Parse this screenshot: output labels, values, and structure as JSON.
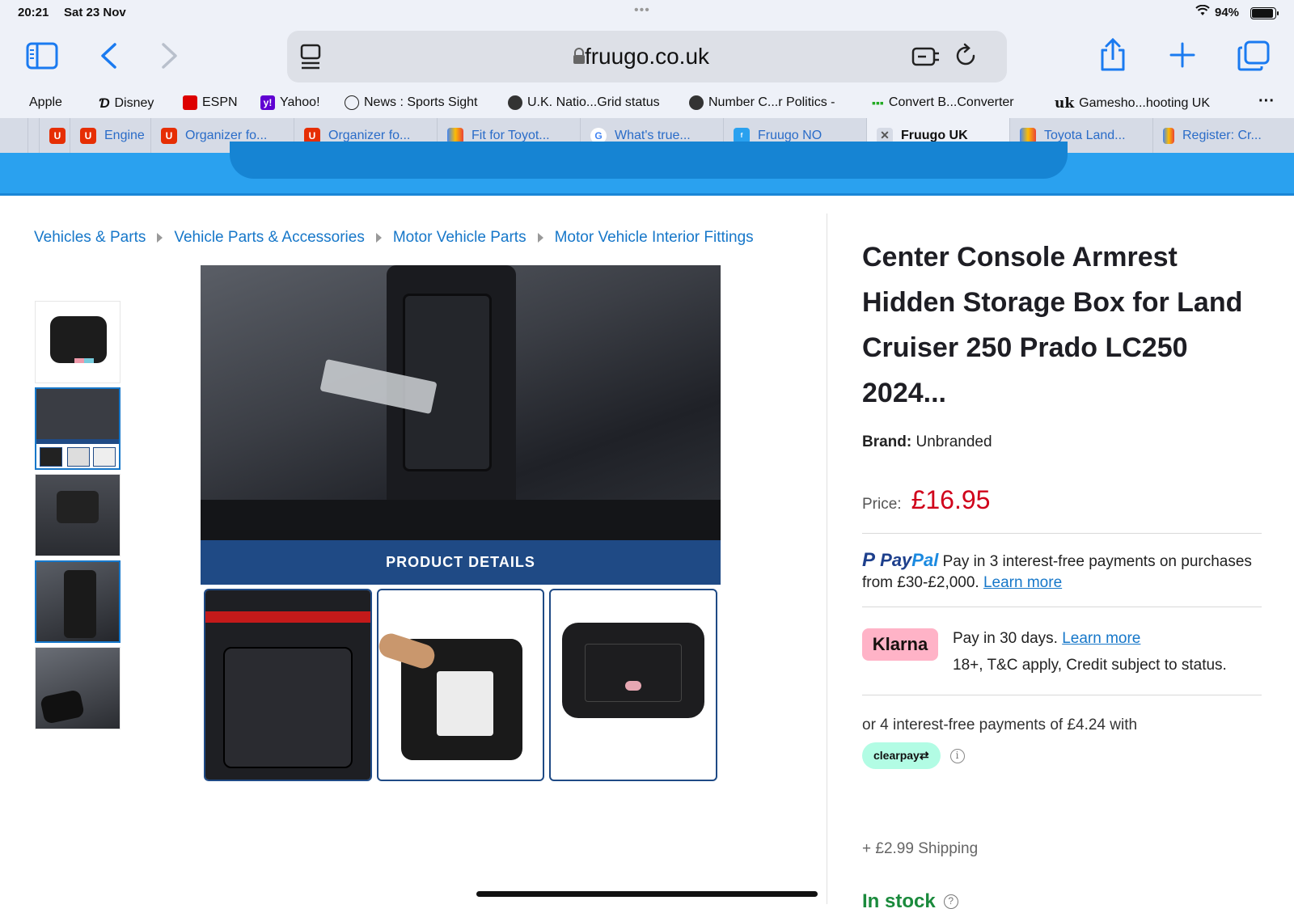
{
  "status": {
    "time": "20:21",
    "date": "Sat 23 Nov",
    "battery": "94%",
    "battery_level": 0.94
  },
  "browser": {
    "url": "fruugo.co.uk"
  },
  "favourites": [
    "Apple",
    "Disney",
    "ESPN",
    "Yahoo!",
    "News : Sports Sight",
    "U.K. Natio...Grid status",
    "Number C...r Politics -",
    "Convert B...Converter",
    "Gamesho...hooting UK"
  ],
  "tabs": [
    {
      "label": "Engine"
    },
    {
      "label": "Organizer fo..."
    },
    {
      "label": "Organizer fo..."
    },
    {
      "label": "Fit for Toyot..."
    },
    {
      "label": "What's true..."
    },
    {
      "label": "Fruugo NO"
    },
    {
      "label": "Fruugo UK"
    },
    {
      "label": "Toyota Land..."
    },
    {
      "label": "Register: Cr..."
    }
  ],
  "breadcrumb": [
    "Vehicles & Parts",
    "Vehicle Parts & Accessories",
    "Motor Vehicle Parts",
    "Motor Vehicle Interior Fittings"
  ],
  "gallery": {
    "banner": "PRODUCT DETAILS"
  },
  "product": {
    "title": "Center Console Armrest Hidden Storage Box for Land Cruiser 250 Prado LC250 2024...",
    "brand_label": "Brand:",
    "brand": "Unbranded",
    "price_label": "Price:",
    "price": "£16.95",
    "paypal_logo_a": "Pay",
    "paypal_logo_b": "Pal",
    "paypal_text": "Pay in 3 interest-free payments on purchases from £30-£2,000.",
    "learn_more": "Learn more",
    "klarna_badge": "Klarna",
    "klarna_line1": "Pay in 30 days.",
    "klarna_line2": "18+, T&C apply, Credit subject to status.",
    "clearpay_text": "or 4 interest-free payments of £4.24 with",
    "clearpay_badge": "clearpay⇄",
    "shipping": "+ £2.99 Shipping",
    "stock": "In stock"
  }
}
